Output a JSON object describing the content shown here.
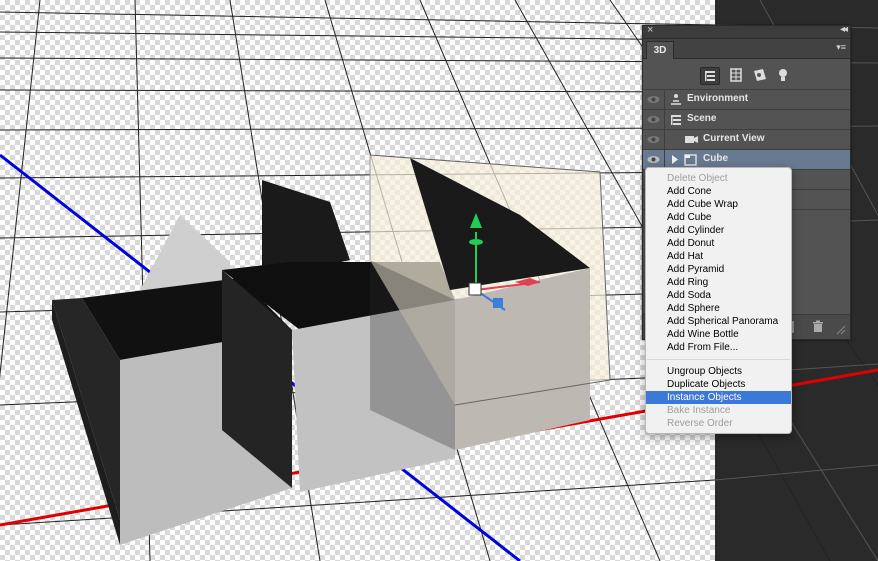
{
  "panel": {
    "close_glyph": "×",
    "collapse_glyph": "◂◂",
    "tab_label": "3D",
    "menu_glyph": "▾≡",
    "filter_icons": [
      "whole-scene-icon",
      "meshes-icon",
      "materials-icon",
      "lights-icon"
    ],
    "layers": [
      {
        "label": "Environment",
        "icon": "environment-icon"
      },
      {
        "label": "Scene",
        "icon": "scene-icon"
      },
      {
        "label": "Current View",
        "icon": "camera-icon"
      },
      {
        "label": "Cube",
        "icon": "folder-icon",
        "selected": true
      }
    ],
    "delete_icon": "trash-icon"
  },
  "context_menu": {
    "group1": [
      {
        "label": "Delete Object",
        "disabled": true
      },
      {
        "label": "Add Cone"
      },
      {
        "label": "Add Cube Wrap"
      },
      {
        "label": "Add Cube"
      },
      {
        "label": "Add Cylinder"
      },
      {
        "label": "Add Donut"
      },
      {
        "label": "Add Hat"
      },
      {
        "label": "Add Pyramid"
      },
      {
        "label": "Add Ring"
      },
      {
        "label": "Add Soda"
      },
      {
        "label": "Add Sphere"
      },
      {
        "label": "Add Spherical Panorama"
      },
      {
        "label": "Add Wine Bottle"
      },
      {
        "label": "Add From File..."
      }
    ],
    "group2": [
      {
        "label": "Ungroup Objects"
      },
      {
        "label": "Duplicate Objects"
      },
      {
        "label": "Instance Objects",
        "highlighted": true
      },
      {
        "label": "Bake Instance",
        "disabled": true
      },
      {
        "label": "Reverse Order",
        "disabled": true
      }
    ]
  },
  "colors": {
    "selection_row": "#687a91",
    "menu_highlight": "#3c78d8",
    "axis_x": "#e00000",
    "axis_z": "#0000dd",
    "gizmo_y": "#22cc55"
  }
}
